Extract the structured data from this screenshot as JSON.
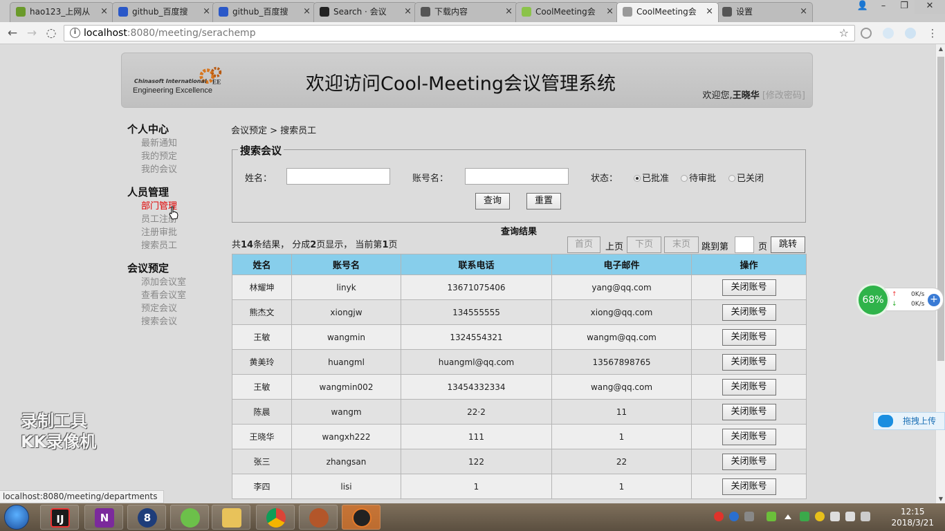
{
  "browser": {
    "tabs": [
      {
        "title": "hao123_上网从",
        "color": "#6a9a2a"
      },
      {
        "title": "github_百度搜",
        "color": "#2a58c8"
      },
      {
        "title": "github_百度搜",
        "color": "#2a58c8"
      },
      {
        "title": "Search · 会议",
        "color": "#222222"
      },
      {
        "title": "下载内容",
        "color": "#555555"
      },
      {
        "title": "CoolMeeting会",
        "color": "#8bc34a"
      },
      {
        "title": "CoolMeeting会",
        "color": "#999999"
      },
      {
        "title": "设置",
        "color": "#555555"
      }
    ],
    "url_host": "localhost",
    "url_path": ":8080/meeting/serachemp",
    "status_url": "localhost:8080/meeting/departments"
  },
  "header": {
    "logo_line1": "Chinasoft International",
    "logo_line2": "Engineering Excellence",
    "title": "欢迎访问Cool-Meeting会议管理系统",
    "welcome_prefix": "欢迎您,",
    "username": "王晓华",
    "change_password": "[修改密码]"
  },
  "sidebar": {
    "groups": [
      {
        "title": "个人中心",
        "items": [
          "最新通知",
          "我的预定",
          "我的会议"
        ]
      },
      {
        "title": "人员管理",
        "items": [
          "部门管理",
          "员工注册",
          "注册审批",
          "搜索员工"
        ]
      },
      {
        "title": "会议预定",
        "items": [
          "添加会议室",
          "查看会议室",
          "预定会议",
          "搜索会议"
        ]
      }
    ]
  },
  "breadcrumb": "会议预定 > 搜索员工",
  "search": {
    "legend": "搜索会议",
    "name_label": "姓名：",
    "account_label": "账号名：",
    "status_label": "状态：",
    "status_options": [
      "已批准",
      "待审批",
      "已关闭"
    ],
    "query_button": "查询",
    "reset_button": "重置"
  },
  "results": {
    "title": "查询结果",
    "summary": {
      "p1": "共",
      "total": "14",
      "p2": "条结果， 分成",
      "pages": "2",
      "p3": "页显示， 当前第",
      "current": "1",
      "p4": "页"
    },
    "pager": {
      "first": "首页",
      "prev": "上页",
      "next": "下页",
      "last": "末页",
      "jump_label": "跳到第",
      "page_unit": "页",
      "jump_button": "跳转"
    },
    "columns": [
      "姓名",
      "账号名",
      "联系电话",
      "电子邮件",
      "操作"
    ],
    "rows": [
      [
        "林耀坤",
        "linyk",
        "13671075406",
        "yang@qq.com",
        "关闭账号"
      ],
      [
        "熊杰文",
        "xiongjw",
        "134555555",
        "xiong@qq.com",
        "关闭账号"
      ],
      [
        "王敏",
        "wangmin",
        "1324554321",
        "wangm@qq.com",
        "关闭账号"
      ],
      [
        "黄美玲",
        "huangml",
        "huangml@qq.com",
        "13567898765",
        "关闭账号"
      ],
      [
        "王敏",
        "wangmin002",
        "13454332334",
        "wang@qq.com",
        "关闭账号"
      ],
      [
        "陈晨",
        "wangm",
        "22·2",
        "11",
        "关闭账号"
      ],
      [
        "王晓华",
        "wangxh222",
        "111",
        "1",
        "关闭账号"
      ],
      [
        "张三",
        "zhangsan",
        "122",
        "22",
        "关闭账号"
      ],
      [
        "李四",
        "lisi",
        "1",
        "1",
        "关闭账号"
      ]
    ]
  },
  "overlays": {
    "watermark": [
      "录制工具",
      "KK录像机"
    ],
    "net_percent": "68%",
    "net_up": "0K/s",
    "net_down": "0K/s",
    "upload_label": "拖拽上传"
  },
  "taskbar": {
    "time": "12:15",
    "date": "2018/3/21"
  }
}
